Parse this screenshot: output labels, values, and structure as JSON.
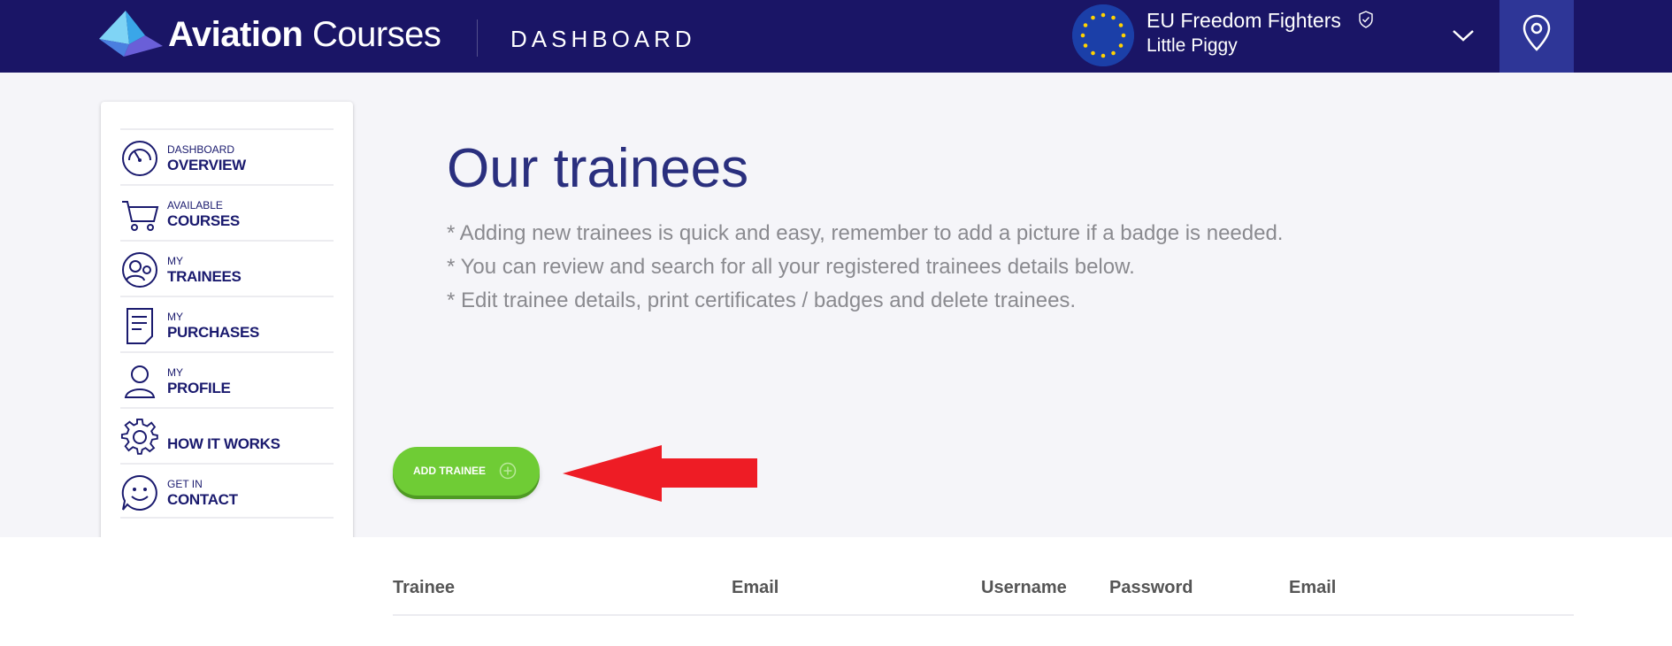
{
  "header": {
    "brand_bold": "Aviation",
    "brand_light": "Courses",
    "section": "DASHBOARD",
    "org_name": "EU Freedom Fighters",
    "user_name": "Little Piggy"
  },
  "sidebar": {
    "items": [
      {
        "small": "DASHBOARD",
        "big": "OVERVIEW",
        "icon": "speedometer-icon"
      },
      {
        "small": "AVAILABLE",
        "big": "COURSES",
        "icon": "cart-icon"
      },
      {
        "small": "MY",
        "big": "TRAINEES",
        "icon": "trainees-icon"
      },
      {
        "small": "MY",
        "big": "PURCHASES",
        "icon": "document-icon"
      },
      {
        "small": "MY",
        "big": "PROFILE",
        "icon": "user-icon"
      },
      {
        "small": "",
        "big": "HOW IT WORKS",
        "icon": "gear-icon"
      },
      {
        "small": "GET IN",
        "big": "CONTACT",
        "icon": "smiley-icon"
      }
    ]
  },
  "main": {
    "title": "Our trainees",
    "notes": [
      "* Adding new trainees is quick and easy, remember to add a picture if a badge is needed.",
      "* You can review and search for all your registered trainees details below.",
      "* Edit trainee details, print certificates / badges and delete trainees."
    ],
    "add_button": "ADD TRAINEE"
  },
  "table": {
    "columns": [
      "Trainee",
      "Email",
      "Username",
      "Password",
      "Email"
    ]
  },
  "colors": {
    "header_bg": "#1a1566",
    "accent_green": "#6fcc35",
    "arrow_red": "#ee1c25",
    "title_blue": "#2a2f7e"
  }
}
